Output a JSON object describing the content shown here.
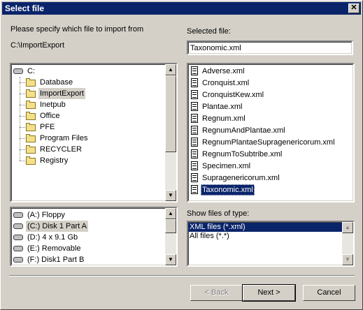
{
  "window": {
    "title": "Select file",
    "close_glyph": "✕"
  },
  "instruction": "Please specify which file to import from",
  "current_path": "C:\\ImportExport",
  "selected_file_label": "Selected file:",
  "selected_file_value": "Taxonomic.xml",
  "folder_tree": {
    "root": "C:",
    "folders": [
      "Database",
      "ImportExport",
      "Inetpub",
      "Office",
      "PFE",
      "Program Files",
      "RECYCLER",
      "Registry"
    ],
    "selected": "ImportExport"
  },
  "drives": [
    {
      "letter": "(A:)",
      "name": "Floppy"
    },
    {
      "letter": "(C:)",
      "name": "Disk 1 Part A"
    },
    {
      "letter": "(D:)",
      "name": "4 x 9.1 Gb"
    },
    {
      "letter": "(E:)",
      "name": "Removable"
    },
    {
      "letter": "(F:)",
      "name": "Disk1 Part B"
    }
  ],
  "files": [
    "Adverse.xml",
    "Cronquist.xml",
    "CronquistKew.xml",
    "Plantae.xml",
    "Regnum.xml",
    "RegnumAndPlantae.xml",
    "RegnumPlantaeSupragenericorum.xml",
    "RegnumToSubtribe.xml",
    "Specimen.xml",
    "Supragenericorum.xml",
    "Taxonomic.xml"
  ],
  "selected_file_index": 10,
  "file_type_label": "Show files of type:",
  "file_types": [
    "XML files (*.xml)",
    "All files (*.*)"
  ],
  "buttons": {
    "back": "< Back",
    "next": "Next >",
    "cancel": "Cancel"
  },
  "icons": {
    "folder": "folder-icon",
    "drive": "drive-icon",
    "file": "file-icon",
    "scroll_up": "scroll-up-arrow-icon",
    "scroll_down": "scroll-down-arrow-icon"
  },
  "colors": {
    "selection": "#0a246a",
    "titlebar": "#0a246a",
    "face": "#d4d0c8"
  }
}
